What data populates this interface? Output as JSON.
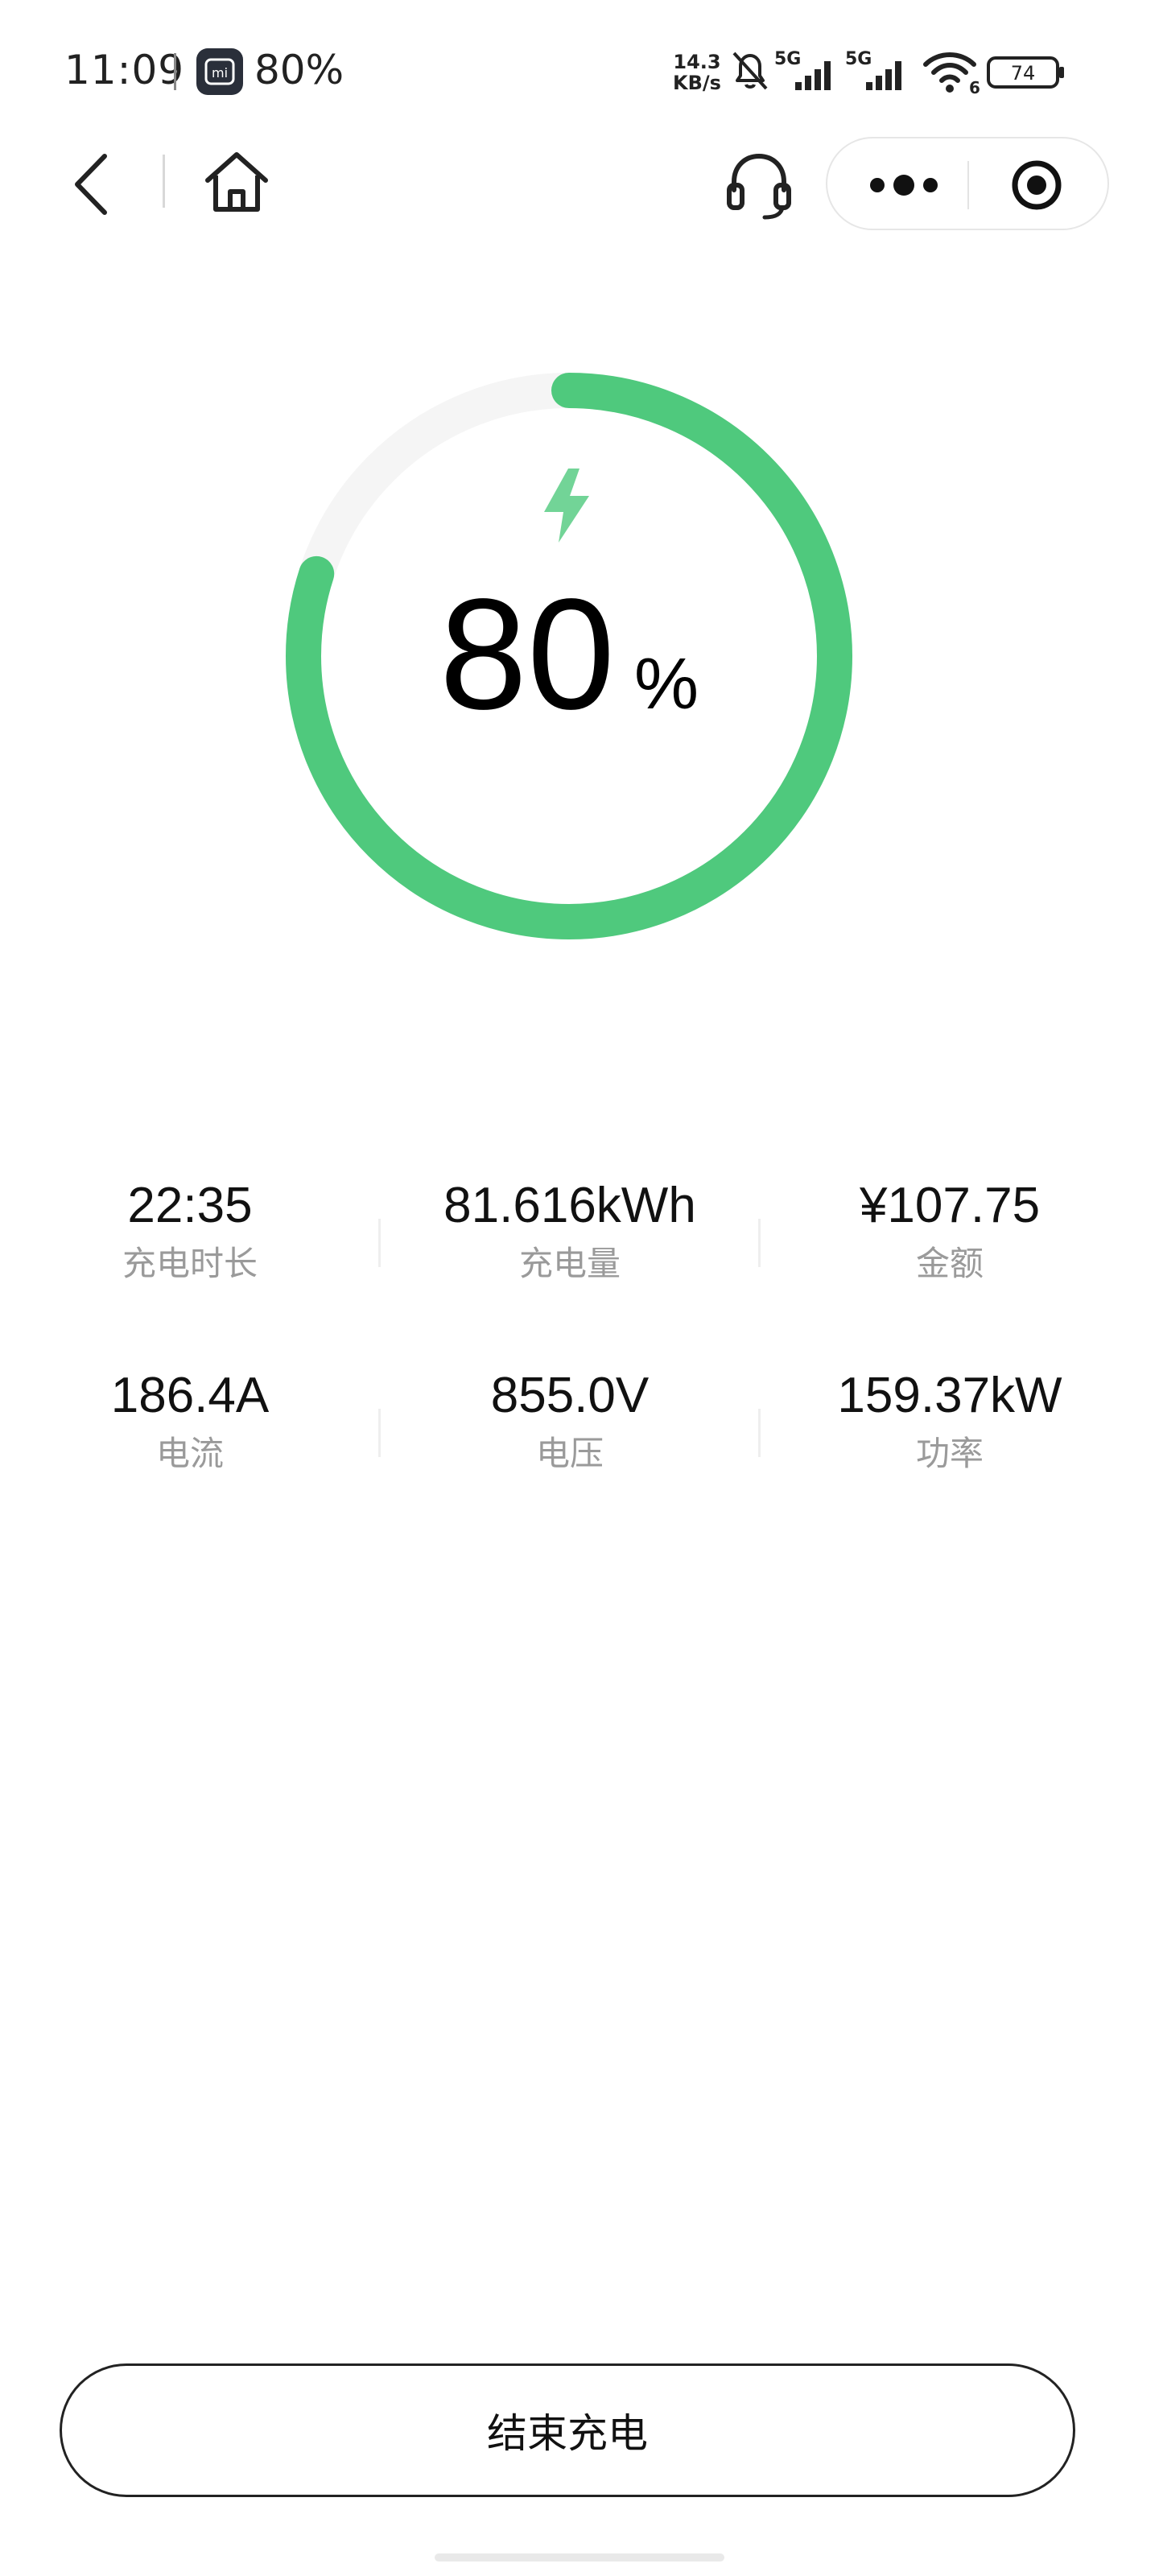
{
  "status_bar": {
    "time": "11:09",
    "battery_percent": "80%",
    "net_speed_value": "14.3",
    "net_speed_unit": "KB/s",
    "signal_1_label": "5G",
    "signal_2_label": "5G",
    "wifi_label": "6",
    "battery_level": "74",
    "app_icon_text": "mi"
  },
  "nav": {
    "back_icon": "chevron-left-icon",
    "home_icon": "home-icon",
    "support_icon": "headset-icon",
    "more_icon": "more-dots-icon",
    "close_icon": "target-circle-icon"
  },
  "charging": {
    "percent": 80,
    "percent_text": "80",
    "unit": "%",
    "ring_color": "#4fc97d",
    "track_color": "#f5f5f5",
    "icon": "bolt-icon"
  },
  "stats": [
    {
      "value": "22:35",
      "label": "充电时长"
    },
    {
      "value": "81.616kWh",
      "label": "充电量"
    },
    {
      "value": "¥107.75",
      "label": "金额"
    },
    {
      "value": "186.4A",
      "label": "电流"
    },
    {
      "value": "855.0V",
      "label": "电压"
    },
    {
      "value": "159.37kW",
      "label": "功率"
    }
  ],
  "actions": {
    "end_charging_label": "结束充电"
  }
}
